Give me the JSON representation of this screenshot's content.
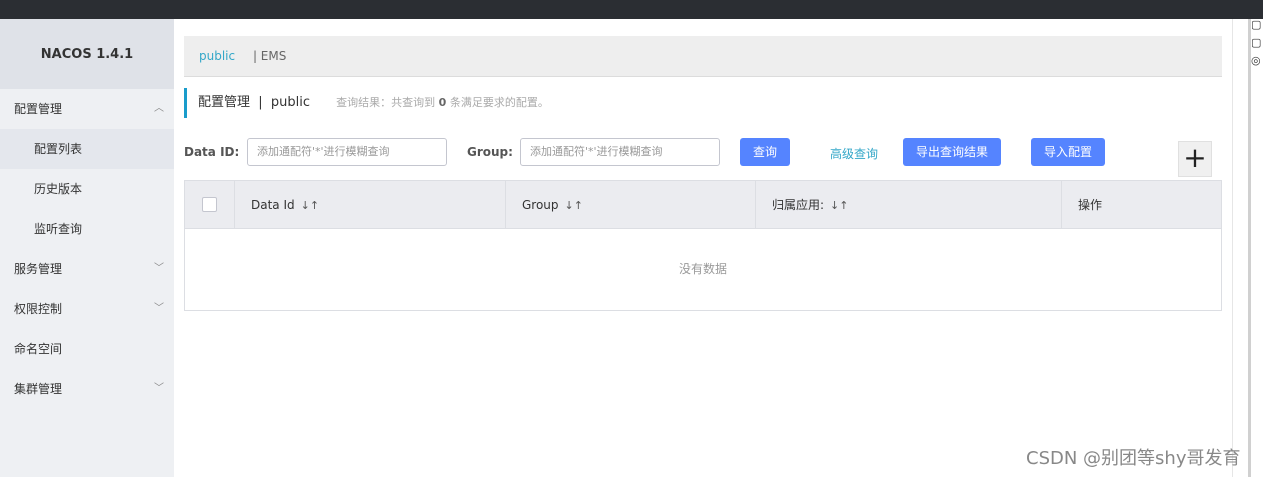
{
  "app": {
    "brand": "NACOS 1.4.1"
  },
  "sidebar": {
    "items": [
      {
        "label": "配置管理",
        "chevron": "chevron-up-icon"
      },
      {
        "label": "配置列表"
      },
      {
        "label": "历史版本"
      },
      {
        "label": "监听查询"
      },
      {
        "label": "服务管理",
        "chevron": "chevron-down-icon"
      },
      {
        "label": "权限控制",
        "chevron": "chevron-down-icon"
      },
      {
        "label": "命名空间"
      },
      {
        "label": "集群管理",
        "chevron": "chevron-down-icon"
      }
    ]
  },
  "namespace": {
    "active": "public",
    "other": "| EMS"
  },
  "title": {
    "main": "配置管理  |  public",
    "hint_prefix": "查询结果：共查询到",
    "hint_count": "0",
    "hint_suffix": "条满足要求的配置。"
  },
  "filters": {
    "dataid_label": "Data ID:",
    "dataid_placeholder": "添加通配符'*'进行模糊查询",
    "group_label": "Group:",
    "group_placeholder": "添加通配符'*'进行模糊查询",
    "query_button": "查询",
    "advanced_link": "高级查询",
    "export_button": "导出查询结果",
    "import_button": "导入配置",
    "add_symbol": "+"
  },
  "table": {
    "columns": [
      "Data Id",
      "Group",
      "归属应用:",
      "操作"
    ],
    "empty_text": "没有数据"
  },
  "watermark": "CSDN @别团等shy哥发育",
  "colors": {
    "accent": "#5584ff",
    "link": "#33a7c8",
    "title_bar": "#1a9ccb"
  }
}
